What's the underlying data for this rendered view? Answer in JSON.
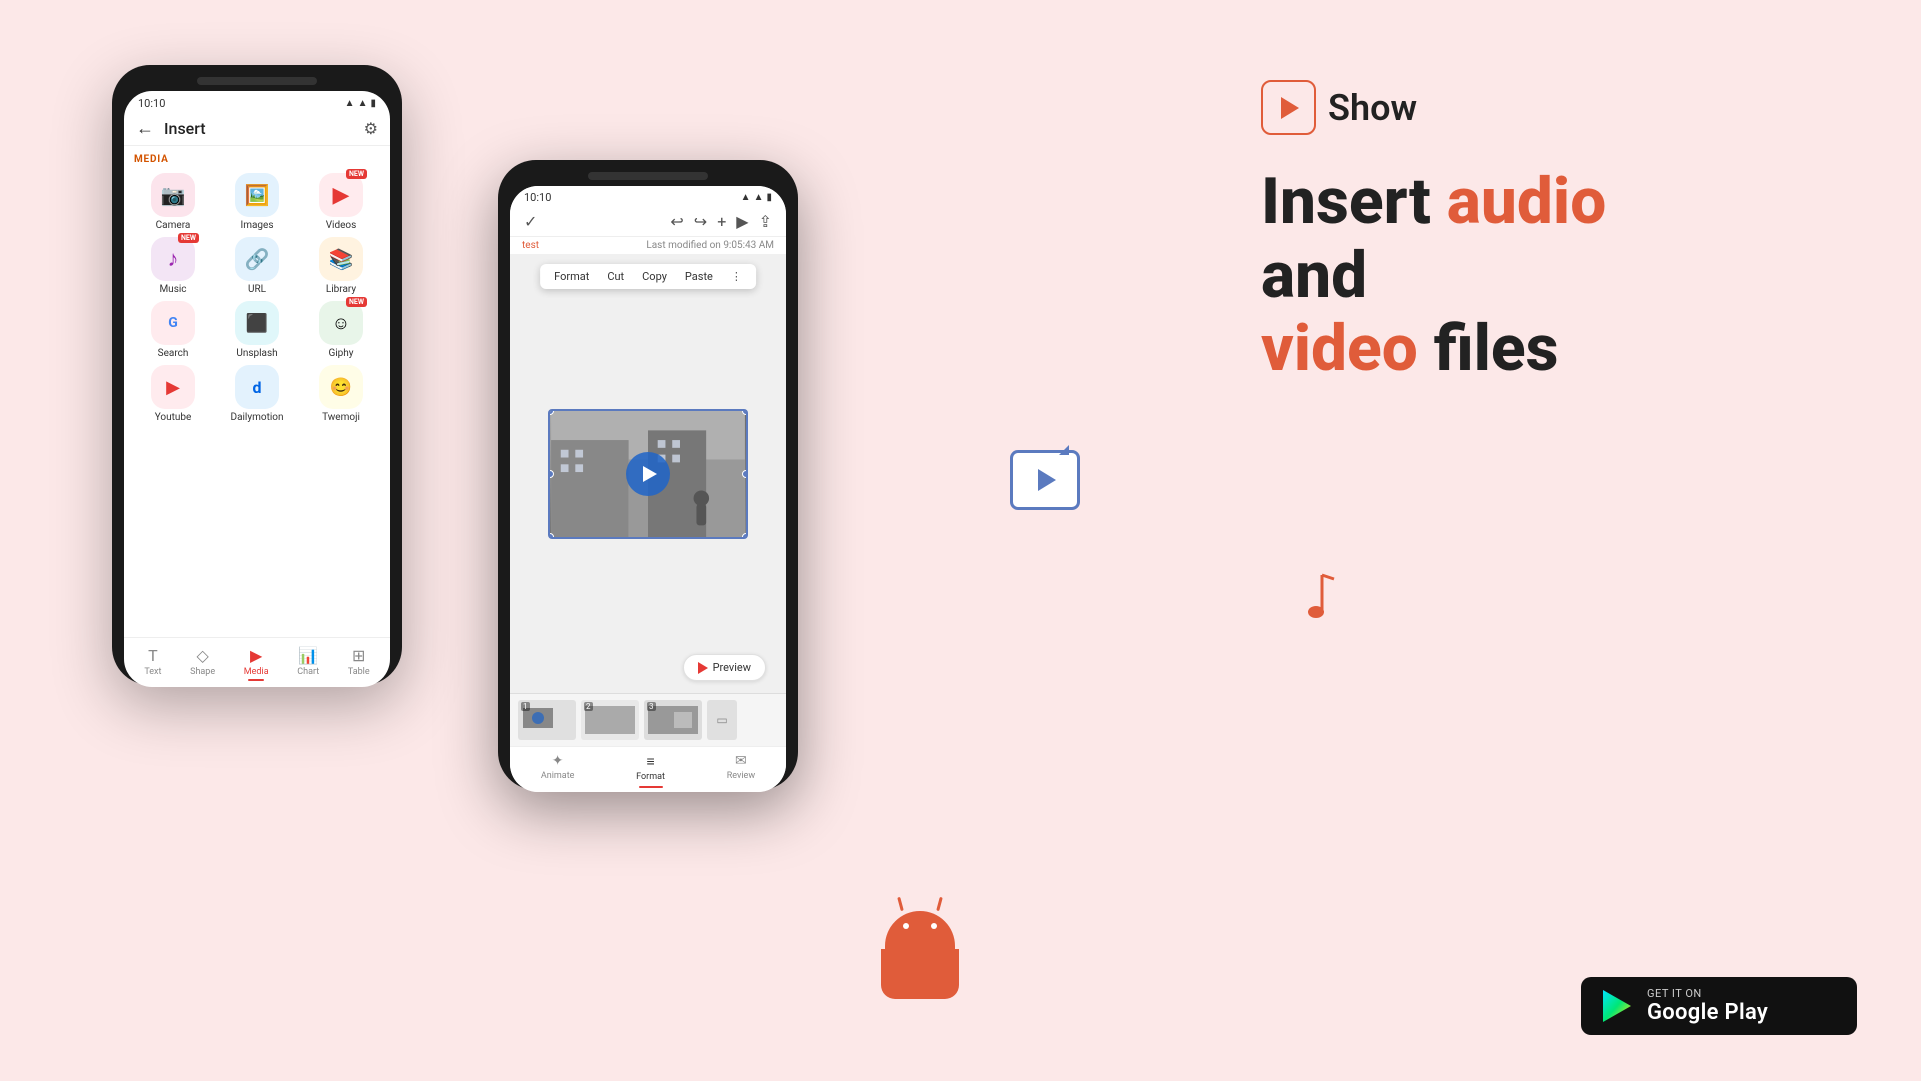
{
  "app": {
    "brand": "Show",
    "headline_part1": "Insert ",
    "headline_accent1": "audio",
    "headline_part2": " and",
    "headline_line2_accent": "video",
    "headline_line2_rest": " files"
  },
  "phone_left": {
    "status_time": "10:10",
    "page_title": "Insert",
    "section_media": "MEDIA",
    "items": [
      {
        "label": "Camera",
        "icon": "📷",
        "bg": "pink",
        "new": false
      },
      {
        "label": "Images",
        "icon": "🖼️",
        "bg": "blue",
        "new": false
      },
      {
        "label": "Videos",
        "icon": "▶",
        "bg": "red",
        "new": true
      },
      {
        "label": "Music",
        "icon": "🎵",
        "bg": "purple",
        "new": true
      },
      {
        "label": "URL",
        "icon": "🔗",
        "bg": "blue",
        "new": false
      },
      {
        "label": "Library",
        "icon": "📚",
        "bg": "orange",
        "new": false
      },
      {
        "label": "Search",
        "icon": "G",
        "bg": "red",
        "new": false
      },
      {
        "label": "Unsplash",
        "icon": "⬛",
        "bg": "teal",
        "new": false
      },
      {
        "label": "Giphy",
        "icon": "☺",
        "bg": "green",
        "new": true
      },
      {
        "label": "Youtube",
        "icon": "▶",
        "bg": "red",
        "new": false
      },
      {
        "label": "Dailymotion",
        "icon": "d",
        "bg": "blue",
        "new": false
      },
      {
        "label": "Twemoji",
        "icon": "😊",
        "bg": "yellow",
        "new": false
      }
    ],
    "nav_items": [
      {
        "label": "Text",
        "icon": "T",
        "active": false
      },
      {
        "label": "Shape",
        "icon": "◇",
        "active": false
      },
      {
        "label": "Media",
        "icon": "▶",
        "active": true
      },
      {
        "label": "Chart",
        "icon": "📊",
        "active": false
      },
      {
        "label": "Table",
        "icon": "⊞",
        "active": false
      }
    ]
  },
  "phone_right": {
    "status_time": "10:10",
    "slide_name": "test",
    "last_modified": "Last modified on 9:05:43 AM",
    "context_menu": [
      "Format",
      "Cut",
      "Copy",
      "Paste"
    ],
    "preview_label": "Preview",
    "tabs": [
      {
        "label": "Animate",
        "active": false
      },
      {
        "label": "Format",
        "active": true
      },
      {
        "label": "Review",
        "active": false
      }
    ]
  },
  "google_play": {
    "get_it_on": "GET IT ON",
    "store_name": "Google Play"
  }
}
